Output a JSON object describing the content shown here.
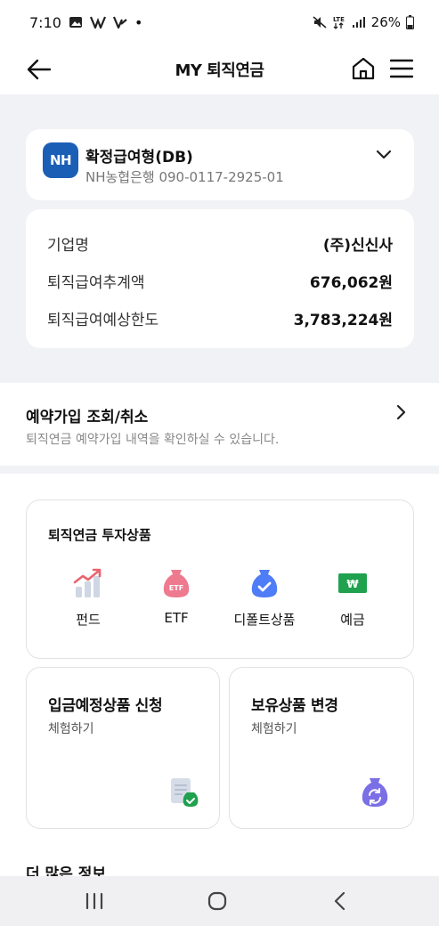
{
  "status_bar": {
    "time": "7:10",
    "dot": "•",
    "battery": "26%",
    "icons": [
      "gallery-icon",
      "app-icon",
      "app-icon",
      "mute-icon",
      "lte-icon",
      "signal-icon",
      "battery-icon"
    ]
  },
  "header": {
    "title": "MY 퇴직연금",
    "icons": [
      "back-arrow-icon",
      "home-icon",
      "hamburger-menu-icon"
    ]
  },
  "account": {
    "logo_text": "NH",
    "type": "확정급여형(DB)",
    "number": "NH농협은행 090-0117-2925-01"
  },
  "summary": {
    "rows": [
      {
        "label": "기업명",
        "value": "(주)신신사"
      },
      {
        "label": "퇴직급여추계액",
        "value": "676,062원"
      },
      {
        "label": "퇴직급여예상한도",
        "value": "3,783,224원"
      }
    ]
  },
  "reserve": {
    "title": "예약가입 조회/취소",
    "description": "퇴직연금 예약가입 내역을 확인하실 수 있습니다."
  },
  "invest": {
    "title": "퇴직연금 투자상품",
    "products": [
      {
        "label": "펀드",
        "icon": "fund-chart-icon"
      },
      {
        "label": "ETF",
        "icon": "etf-bag-icon",
        "badge": "ETF"
      },
      {
        "label": "디폴트상품",
        "icon": "default-product-bag-icon"
      },
      {
        "label": "예금",
        "icon": "deposit-bill-icon",
        "badge": "₩"
      }
    ]
  },
  "cards": {
    "apply": {
      "title": "입금예정상품 신청",
      "subtitle": "체험하기",
      "icon": "document-check-icon"
    },
    "change": {
      "title": "보유상품 변경",
      "subtitle": "체험하기",
      "icon": "bag-refresh-icon"
    }
  },
  "more_info": "더 많은 정보",
  "colors": {
    "nh_blue": "#1b5eb6",
    "etf_pink": "#ee7a8f",
    "default_blue": "#4f7cf7",
    "deposit_green": "#1fa14e",
    "change_purple": "#7b6fe6",
    "page_bg": "#f1f2f5"
  },
  "nav": [
    "recent-apps-icon",
    "home-circle-icon",
    "back-chevron-icon"
  ]
}
